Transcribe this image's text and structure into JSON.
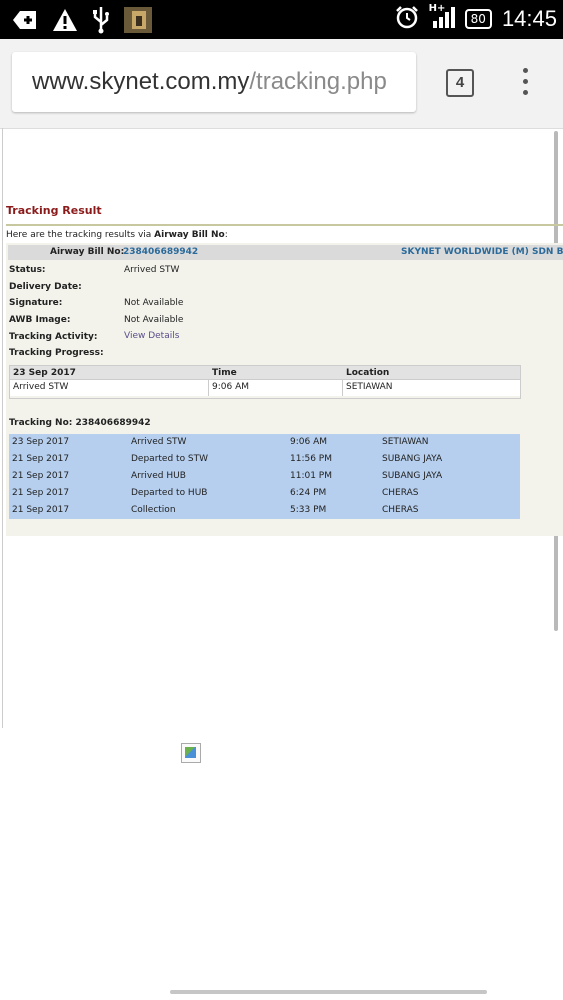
{
  "status_bar": {
    "icons_left": [
      "add-box-icon",
      "warning-icon",
      "usb-icon",
      "app-thumbnail-icon"
    ],
    "icons_right": [
      "alarm-icon",
      "signal-icon"
    ],
    "network": "H+",
    "battery": "80",
    "time": "14:45"
  },
  "browser": {
    "url_domain": "www.skynet.com.my",
    "url_path": "/tracking.php",
    "tab_count": "4"
  },
  "page": {
    "title": "Tracking Result",
    "intro_prefix": "Here are the tracking results via ",
    "intro_bold": "Airway Bill No",
    "intro_suffix": ":",
    "awb_label": "Airway Bill No:",
    "awb_number": "238406689942",
    "company": "SKYNET WORLDWIDE (M) SDN BHD",
    "fields": [
      {
        "label": "Status:",
        "value": "Arrived STW"
      },
      {
        "label": "Delivery Date:",
        "value": ""
      },
      {
        "label": "Signature:",
        "value": "Not Available"
      },
      {
        "label": "AWB Image:",
        "value": "Not Available"
      },
      {
        "label": "Tracking Activity:",
        "value": "View Details"
      },
      {
        "label": "Tracking Progress:",
        "value": ""
      }
    ],
    "progress": {
      "headers": [
        "23 Sep 2017",
        "Time",
        "Location"
      ],
      "row": [
        "Arrived STW",
        "9:06 AM",
        "SETIAWAN"
      ]
    },
    "tracking_no_label": "Tracking No: 238406689942",
    "history": [
      {
        "date": "23 Sep 2017",
        "event": "Arrived STW",
        "time": "9:06 AM",
        "location": "SETIAWAN"
      },
      {
        "date": "21 Sep 2017",
        "event": "Departed to STW",
        "time": "11:56 PM",
        "location": "SUBANG JAYA"
      },
      {
        "date": "21 Sep 2017",
        "event": "Arrived HUB",
        "time": "11:01 PM",
        "location": "SUBANG JAYA"
      },
      {
        "date": "21 Sep 2017",
        "event": "Departed to HUB",
        "time": "6:24 PM",
        "location": "CHERAS"
      },
      {
        "date": "21 Sep 2017",
        "event": "Collection",
        "time": "5:33 PM",
        "location": "CHERAS"
      }
    ]
  }
}
